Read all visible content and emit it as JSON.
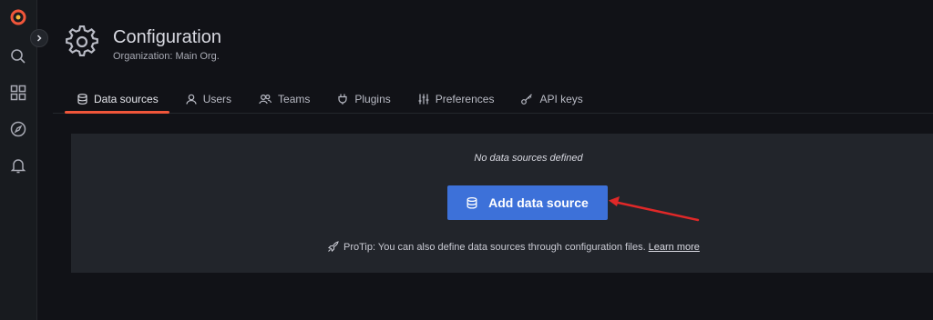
{
  "sidemenu": {
    "items": [
      {
        "icon": "grafana-logo-icon"
      },
      {
        "icon": "search-icon"
      },
      {
        "icon": "dashboards-icon"
      },
      {
        "icon": "explore-icon"
      },
      {
        "icon": "alerting-bell-icon"
      }
    ]
  },
  "header": {
    "title": "Configuration",
    "subtitle": "Organization: Main Org."
  },
  "tabs": [
    {
      "label": "Data sources",
      "icon": "database-icon",
      "active": true
    },
    {
      "label": "Users",
      "icon": "user-icon",
      "active": false
    },
    {
      "label": "Teams",
      "icon": "users-icon",
      "active": false
    },
    {
      "label": "Plugins",
      "icon": "plug-icon",
      "active": false
    },
    {
      "label": "Preferences",
      "icon": "sliders-icon",
      "active": false
    },
    {
      "label": "API keys",
      "icon": "key-icon",
      "active": false
    }
  ],
  "empty_state": {
    "message": "No data sources defined",
    "button_label": "Add data source",
    "protip_text": "ProTip: You can also define data sources through configuration files.",
    "learn_more": "Learn more"
  },
  "colors": {
    "accent": "#f0563a",
    "primary_button": "#3d71d9",
    "annotation_arrow": "#e02828",
    "background": "#111217",
    "panel": "#22252b"
  }
}
